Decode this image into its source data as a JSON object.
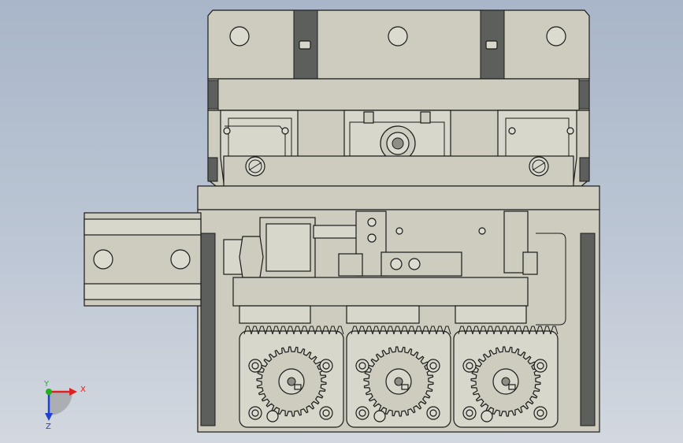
{
  "scene": {
    "background_top": "#a9b6c9",
    "background_bottom": "#d3d8df",
    "part_color": "#cdccbf",
    "edge_color": "#1b1b1b"
  },
  "triad": {
    "x_label": "X",
    "y_label": "Y",
    "z_label": "Z",
    "x_color": "#e02020",
    "y_color": "#20b020",
    "z_color": "#2040d0"
  }
}
